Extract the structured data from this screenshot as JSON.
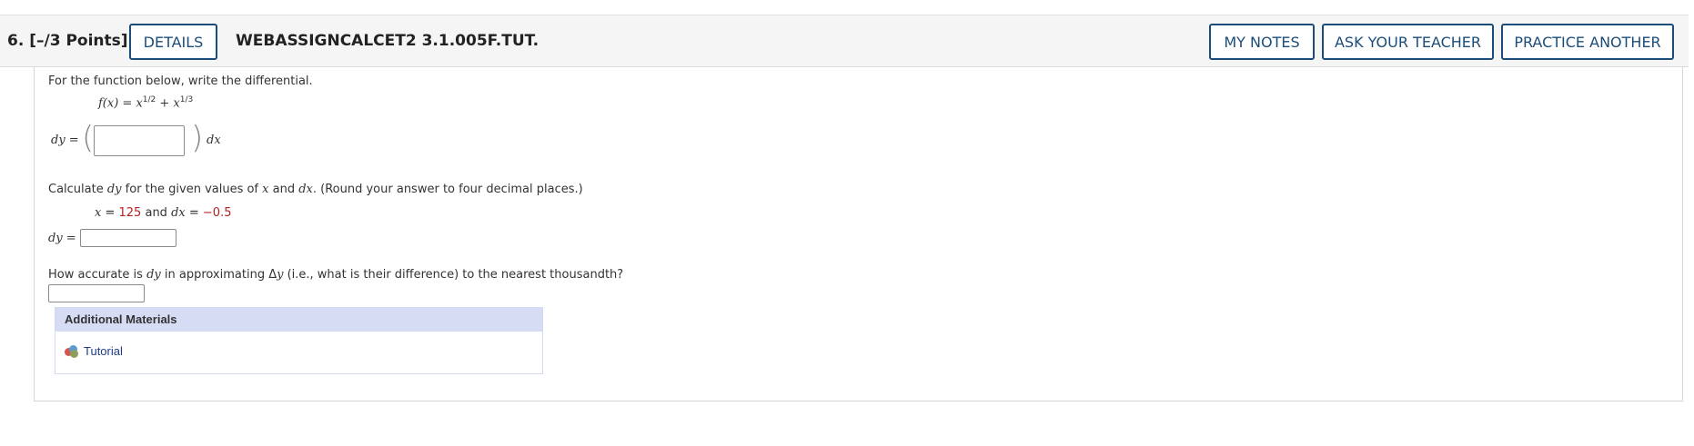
{
  "header": {
    "question_number": "6.",
    "points": "[–/3 Points]",
    "details_label": "DETAILS",
    "question_id": "WEBASSIGNCALCET2 3.1.005F.TUT.",
    "my_notes_label": "MY NOTES",
    "ask_teacher_label": "ASK YOUR TEACHER",
    "practice_label": "PRACTICE ANOTHER"
  },
  "part1": {
    "instruction": "For the function below, write the differential.",
    "function_lhs": "f(x) = x",
    "exp1": "1/2",
    "plus": " + x",
    "exp2": "1/3",
    "dy_label": "dy =",
    "dx_label": "dx",
    "input_value": ""
  },
  "part2": {
    "instruction_a": "Calculate ",
    "instruction_dy": "dy",
    "instruction_b": " for the given values of ",
    "instruction_x": "x",
    "instruction_c": " and ",
    "instruction_dx": "dx",
    "instruction_d": ". (Round your answer to four decimal places.)",
    "x_label": "x",
    "eq": " = ",
    "x_value": "125",
    "and": " and ",
    "dx_label": "dx",
    "dx_value": "−0.5",
    "dy_label": "dy =",
    "input_value": ""
  },
  "part3": {
    "instruction_a": "How accurate is ",
    "instruction_dy": "dy",
    "instruction_b": " in approximating Δ",
    "instruction_y": "y",
    "instruction_c": " (i.e., what is their difference) to the nearest thousandth?",
    "input_value": ""
  },
  "additional_materials": {
    "title": "Additional Materials",
    "tutorial_label": "Tutorial"
  },
  "colors": {
    "button_border": "#1c4d7a",
    "header_bg": "#f5f5f5",
    "am_header_bg": "#d6dcf4",
    "value_red": "#b22222",
    "link_blue": "#1f3c88"
  }
}
